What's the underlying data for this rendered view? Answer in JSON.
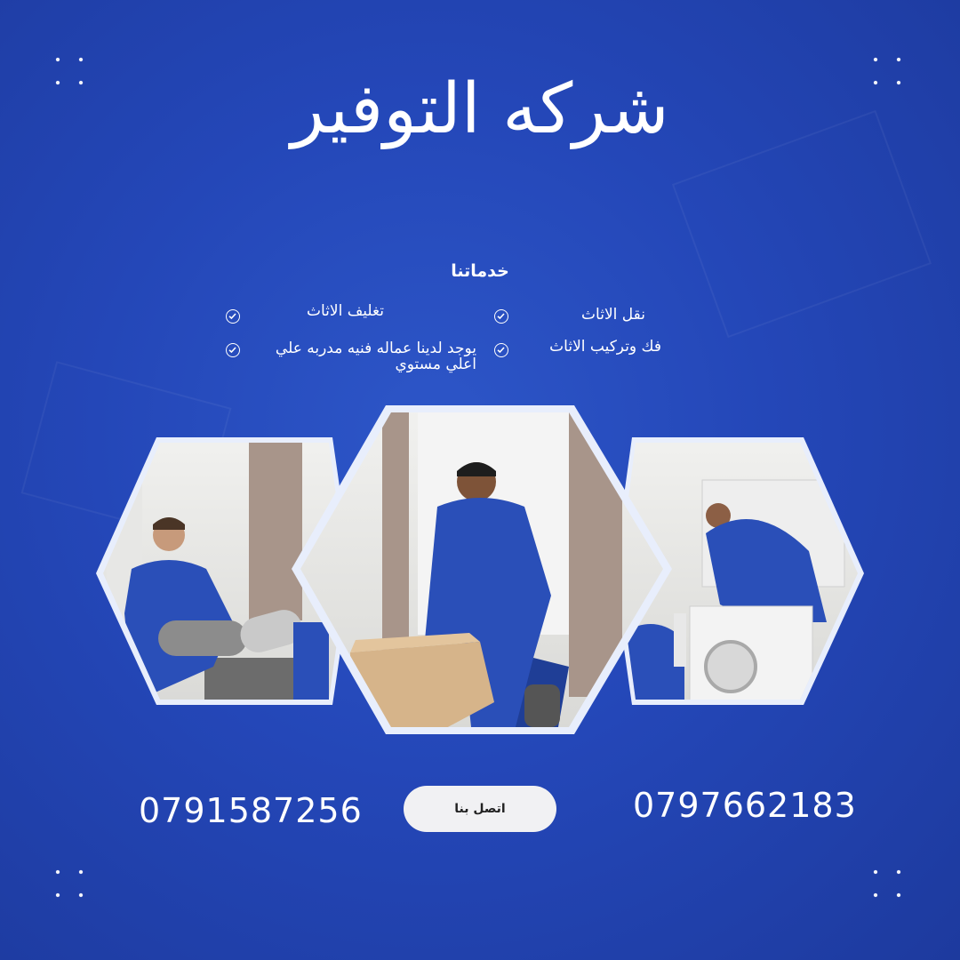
{
  "title": "شركه التوفير",
  "services": {
    "heading": "خدماتنا",
    "items": [
      "نقل الاثاث",
      "فك وتركيب الاثاث",
      "تغليف الاثاث",
      "يوجد لدينا عماله فنيه مدربه علي اعلي مستوي"
    ]
  },
  "photos": [
    {
      "name": "photo-carpet-mover"
    },
    {
      "name": "photo-box-mover"
    },
    {
      "name": "photo-washer-mover"
    }
  ],
  "contact": {
    "phone_left": "0791587256",
    "phone_right": "0797662183",
    "button_label": "اتصل بنا"
  },
  "colors": {
    "background": "#2447b8",
    "uniform": "#2a4fb8",
    "button": "#f1f1f3"
  },
  "icons": [
    "check-circle-icon",
    "dot-grid-icon"
  ]
}
